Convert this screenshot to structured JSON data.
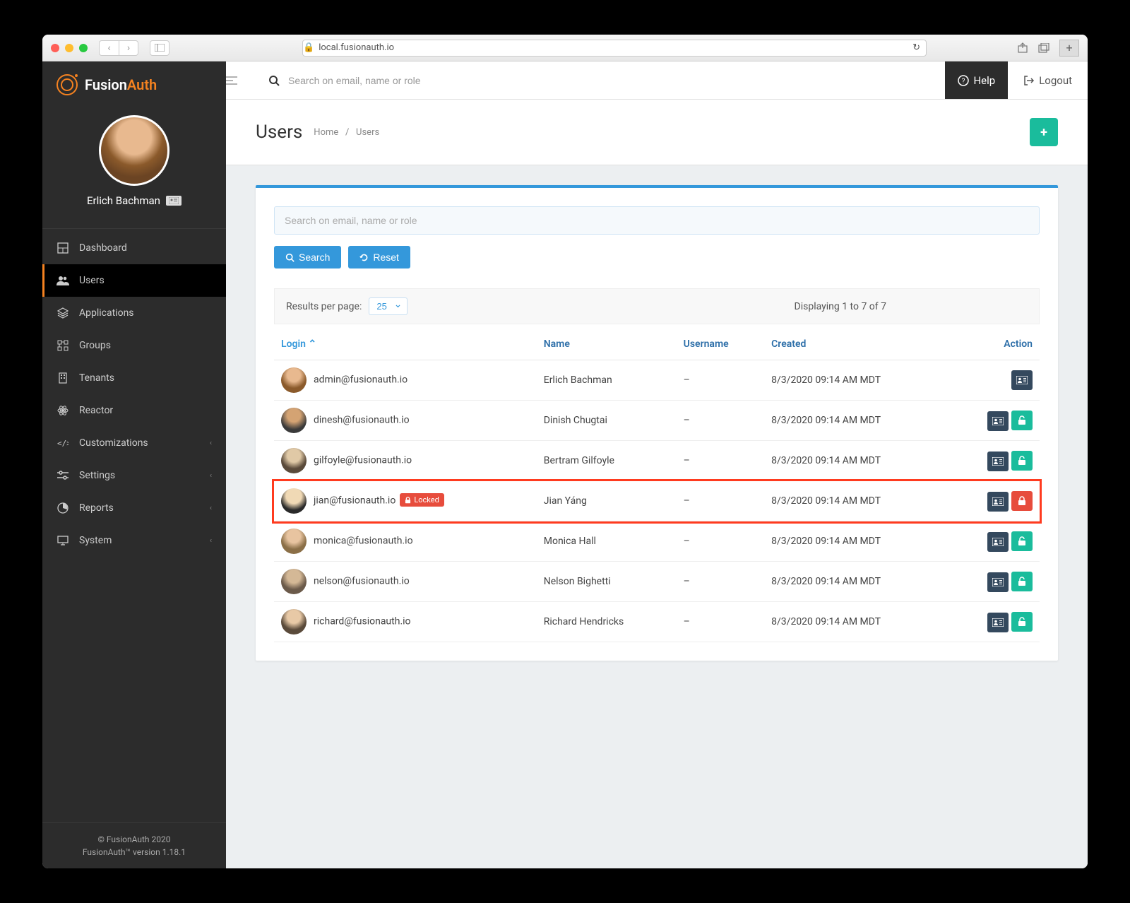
{
  "browser": {
    "url": "local.fusionauth.io"
  },
  "brand": {
    "name_a": "Fusion",
    "name_b": "Auth"
  },
  "profile": {
    "name": "Erlich Bachman"
  },
  "sidebar": {
    "items": [
      {
        "label": "Dashboard"
      },
      {
        "label": "Users"
      },
      {
        "label": "Applications"
      },
      {
        "label": "Groups"
      },
      {
        "label": "Tenants"
      },
      {
        "label": "Reactor"
      },
      {
        "label": "Customizations"
      },
      {
        "label": "Settings"
      },
      {
        "label": "Reports"
      },
      {
        "label": "System"
      }
    ],
    "footer_line1": "© FusionAuth 2020",
    "footer_line2": "FusionAuth™ version 1.18.1"
  },
  "topbar": {
    "search_placeholder": "Search on email, name or role",
    "help": "Help",
    "logout": "Logout"
  },
  "page": {
    "title": "Users",
    "breadcrumb_home": "Home",
    "breadcrumb_sep": "/",
    "breadcrumb_current": "Users"
  },
  "search": {
    "placeholder": "Search on email, name or role",
    "search_btn": "Search",
    "reset_btn": "Reset"
  },
  "results": {
    "per_page_label": "Results per page:",
    "per_page_value": "25",
    "summary": "Displaying 1 to 7 of 7"
  },
  "table": {
    "headers": {
      "login": "Login",
      "name": "Name",
      "username": "Username",
      "created": "Created",
      "action": "Action"
    },
    "sort_indicator": "⌃",
    "rows": [
      {
        "login": "admin@fusionauth.io",
        "name": "Erlich Bachman",
        "username": "–",
        "created": "8/3/2020 09:14 AM MDT",
        "locked": false,
        "self": true
      },
      {
        "login": "dinesh@fusionauth.io",
        "name": "Dinish Chugtai",
        "username": "–",
        "created": "8/3/2020 09:14 AM MDT",
        "locked": false,
        "self": false
      },
      {
        "login": "gilfoyle@fusionauth.io",
        "name": "Bertram Gilfoyle",
        "username": "–",
        "created": "8/3/2020 09:14 AM MDT",
        "locked": false,
        "self": false
      },
      {
        "login": "jian@fusionauth.io",
        "name": "Jian Yáng",
        "username": "–",
        "created": "8/3/2020 09:14 AM MDT",
        "locked": true,
        "self": false
      },
      {
        "login": "monica@fusionauth.io",
        "name": "Monica Hall",
        "username": "–",
        "created": "8/3/2020 09:14 AM MDT",
        "locked": false,
        "self": false
      },
      {
        "login": "nelson@fusionauth.io",
        "name": "Nelson Bighetti",
        "username": "–",
        "created": "8/3/2020 09:14 AM MDT",
        "locked": false,
        "self": false
      },
      {
        "login": "richard@fusionauth.io",
        "name": "Richard Hendricks",
        "username": "–",
        "created": "8/3/2020 09:14 AM MDT",
        "locked": false,
        "self": false
      }
    ],
    "locked_badge": "Locked"
  }
}
